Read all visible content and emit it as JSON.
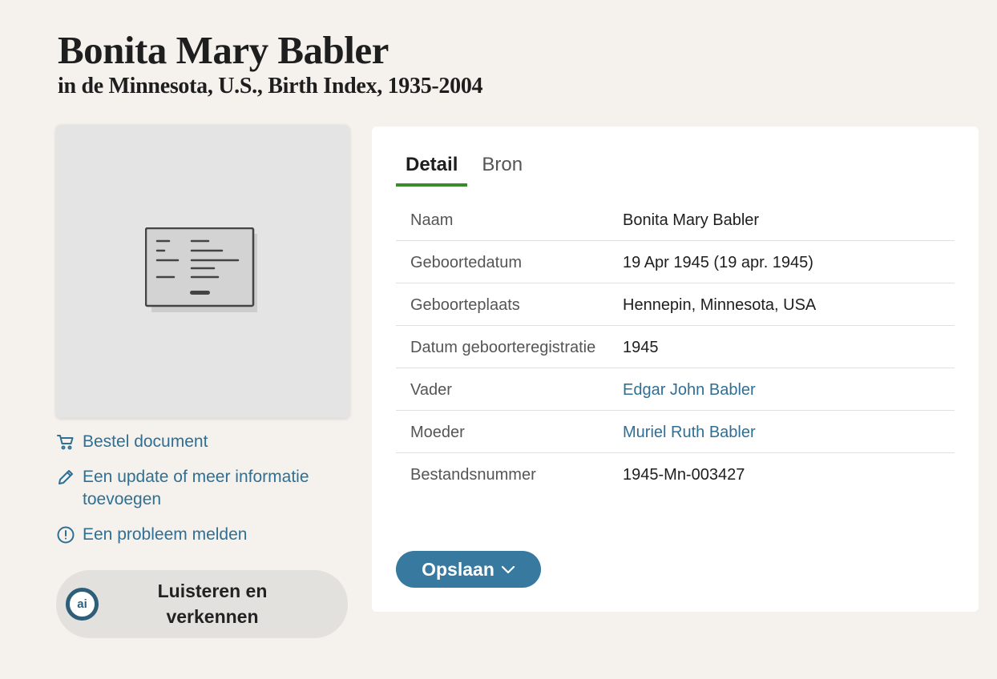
{
  "header": {
    "title": "Bonita Mary Babler",
    "subtitle": "in de Minnesota, U.S., Birth Index, 1935-2004"
  },
  "sidebar": {
    "actions": [
      {
        "label": "Bestel document",
        "icon": "cart-icon"
      },
      {
        "label": "Een update of meer informatie toevoegen",
        "icon": "pencil-icon"
      },
      {
        "label": "Een probleem melden",
        "icon": "alert-circle-icon"
      }
    ],
    "listen": {
      "badge": "ai",
      "label": "Luisteren en verkennen"
    }
  },
  "tabs": [
    {
      "label": "Detail",
      "active": true
    },
    {
      "label": "Bron",
      "active": false
    }
  ],
  "details": [
    {
      "key": "Naam",
      "value": "Bonita Mary Babler"
    },
    {
      "key": "Geboortedatum",
      "value": "19 Apr 1945 (19 apr. 1945)"
    },
    {
      "key": "Geboorteplaats",
      "value": "Hennepin, Minnesota, USA"
    },
    {
      "key": "Datum geboorteregistratie",
      "value": "1945"
    },
    {
      "key": "Vader",
      "value": "Edgar John Babler"
    },
    {
      "key": "Moeder",
      "value": "Muriel Ruth Babler"
    },
    {
      "key": "Bestandsnummer",
      "value": "1945-Mn-003427"
    }
  ],
  "save_button": {
    "label": "Opslaan"
  },
  "colors": {
    "link": "#2f6f93",
    "accent_button": "#37799f",
    "active_tab_underline": "#3c8a2e",
    "background": "#f5f2ee"
  }
}
